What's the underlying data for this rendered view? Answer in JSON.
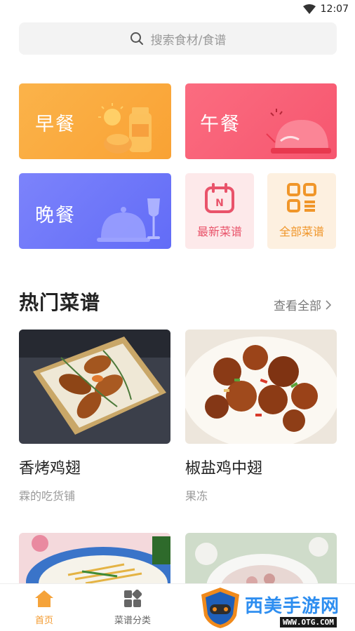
{
  "status_bar": {
    "time": "12:07"
  },
  "search": {
    "placeholder": "搜索食材/食谱"
  },
  "categories": {
    "breakfast": "早餐",
    "lunch": "午餐",
    "dinner": "晚餐",
    "newest": "最新菜谱",
    "all": "全部菜谱"
  },
  "popular": {
    "title": "热门菜谱",
    "see_all": "查看全部",
    "recipes": [
      {
        "name": "香烤鸡翅",
        "author": "霖的吃货铺"
      },
      {
        "name": "椒盐鸡中翅",
        "author": "果冻"
      }
    ]
  },
  "tabbar": {
    "home": "首页",
    "category": "菜谱分类"
  },
  "watermark": {
    "brand": "西美手游网",
    "url": "WWW.OTG.COM"
  },
  "colors": {
    "breakfast": "#f9a234",
    "lunch": "#f6566f",
    "dinner": "#626cf7",
    "accent": "#f39a2e"
  }
}
